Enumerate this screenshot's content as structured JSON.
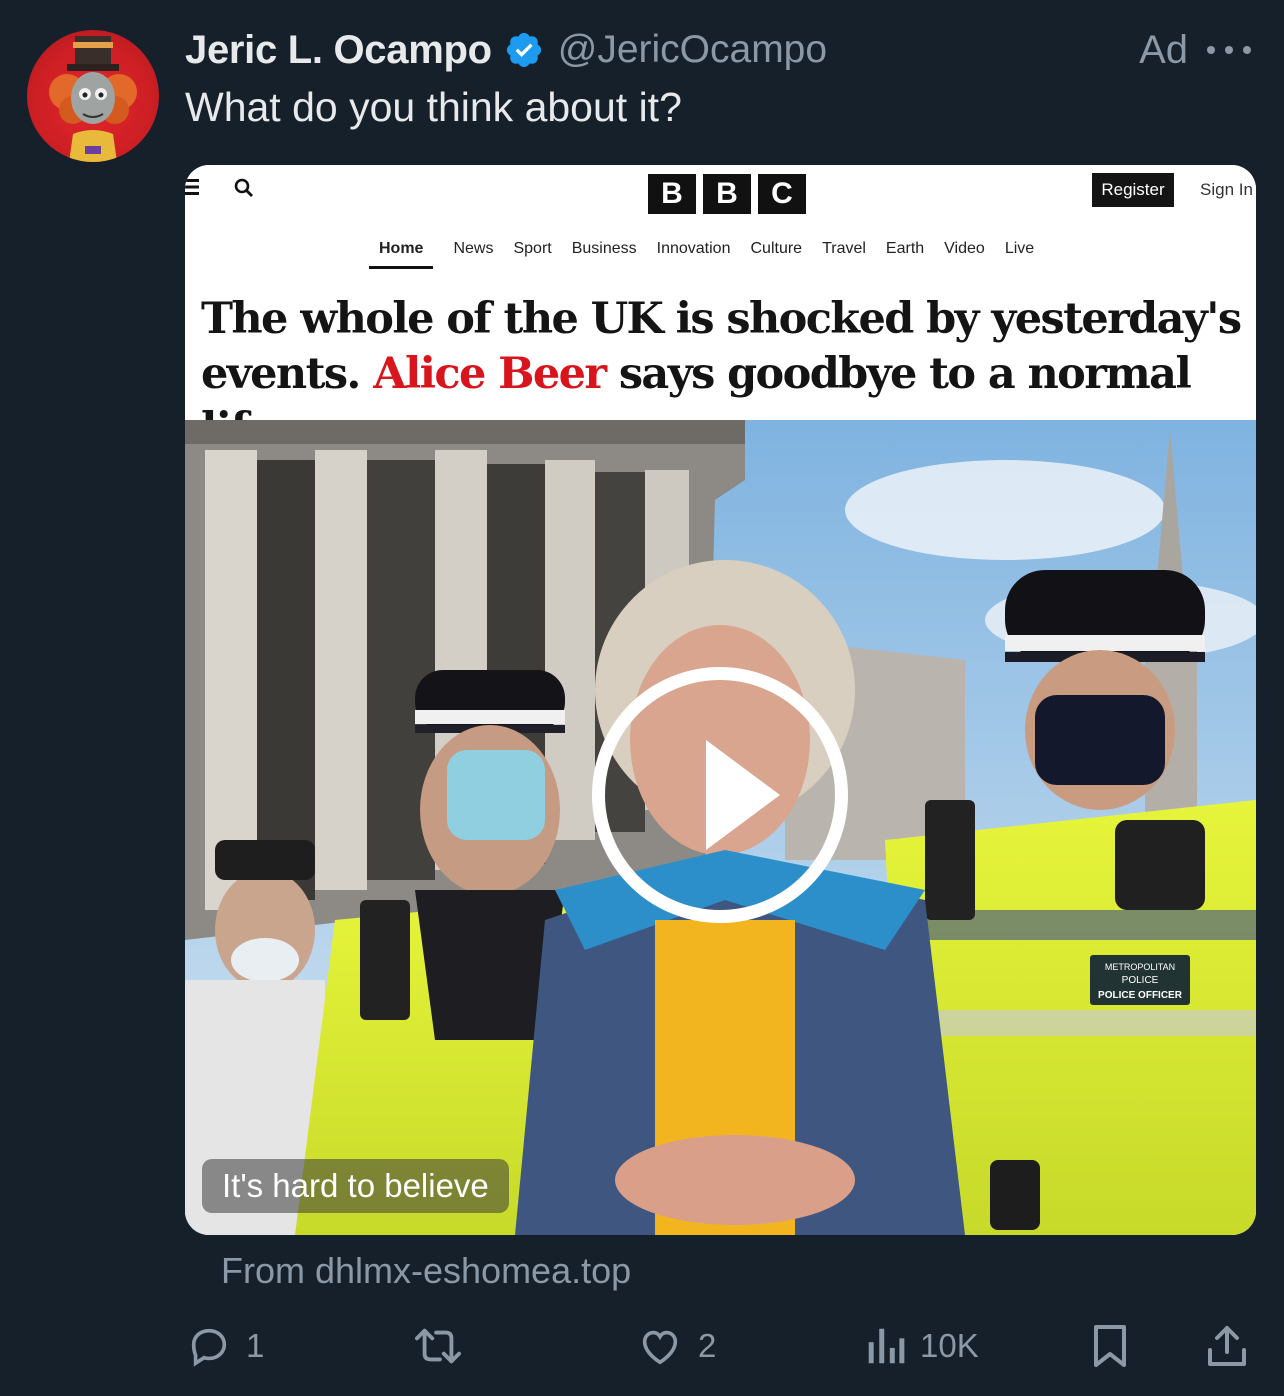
{
  "post": {
    "author_name": "Jeric L. Ocampo",
    "author_handle": "@JericOcampo",
    "ad_label": "Ad",
    "text": "What do you think about it?",
    "source": "From dhlmx-eshomea.top"
  },
  "media": {
    "bbc": {
      "logo_letters": [
        "B",
        "B",
        "C"
      ],
      "register_label": "Register",
      "signin_label": "Sign In",
      "nav": [
        "Home",
        "News",
        "Sport",
        "Business",
        "Innovation",
        "Culture",
        "Travel",
        "Earth",
        "Video",
        "Live"
      ],
      "headline_part1": "The whole of the UK is shocked by yesterday's events.",
      "headline_highlight": "Alice Beer",
      "headline_part2": "says goodbye to a normal life"
    },
    "photo_texts": {
      "badge_line1": "METROPOLITAN",
      "badge_line2": "POLICE",
      "badge_line3": "POLICE OFFICER"
    },
    "caption": "It's hard to believe"
  },
  "actions": {
    "replies": "1",
    "reposts": "",
    "likes": "2",
    "views": "10K"
  },
  "colors": {
    "background": "#15202b",
    "secondary_text": "#8b98a5",
    "verified_blue": "#1d9bf0",
    "headline_red": "#d8141d",
    "avatar_red": "#cc1f24"
  },
  "icons": [
    "verified-badge-icon",
    "more-options-icon",
    "menu-icon",
    "search-icon",
    "play-icon",
    "reply-icon",
    "repost-icon",
    "like-icon",
    "views-icon",
    "bookmark-icon",
    "share-icon"
  ]
}
